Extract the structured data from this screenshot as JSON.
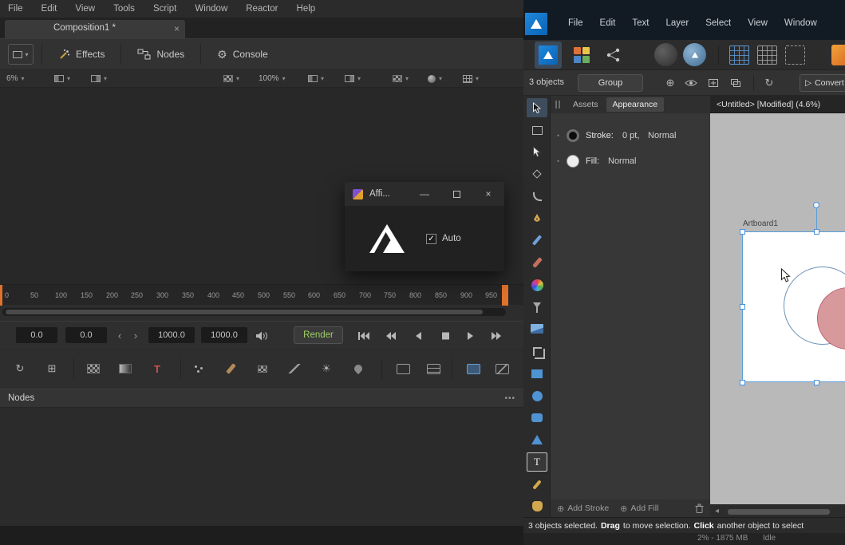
{
  "colors": {
    "accent_blue": "#4a90d9",
    "render_green": "#9ccf63",
    "timeline_orange": "#e0722c",
    "pink_fill": "#d8999d",
    "affinity_blue": "#1a86d8"
  },
  "icons": {
    "close": "×",
    "gear": "⚙",
    "prev": "‹",
    "next": "›",
    "dots_menu": "•••",
    "check": "✓",
    "minimize": "—",
    "bullet": "•",
    "plus": "⊕",
    "crosshair": "⊕",
    "rotate": "↻",
    "sun": "☀",
    "loader": "↻",
    "node_grid": "⊞",
    "scroll_left_arrow": "◂",
    "play_small": "▷",
    "text_tool": "T",
    "text_plus": "T"
  },
  "fusion": {
    "menu": [
      "File",
      "Edit",
      "View",
      "Tools",
      "Script",
      "Window",
      "Reactor",
      "Help"
    ],
    "tab_title": "Composition1 *",
    "toolbar": {
      "effects": "Effects",
      "nodes": "Nodes",
      "console": "Console"
    },
    "viewer_controls": {
      "zoom_left": "6%",
      "zoom_right": "100%"
    },
    "ruler_ticks": [
      "0",
      "50",
      "100",
      "150",
      "200",
      "250",
      "300",
      "350",
      "400",
      "450",
      "500",
      "550",
      "600",
      "650",
      "700",
      "750",
      "800",
      "850",
      "900",
      "950"
    ],
    "transport": {
      "range_start": "0.0",
      "current": "0.0",
      "range_end": "1000.0",
      "global_end": "1000.0",
      "render": "Render"
    },
    "nodes_panel_title": "Nodes",
    "status_memory": "2% - 1875 MB",
    "status_state": "Idle"
  },
  "dialog": {
    "title": "Affi...",
    "auto": "Auto"
  },
  "affinity": {
    "menu": [
      "File",
      "Edit",
      "Text",
      "Layer",
      "Select",
      "View",
      "Window"
    ],
    "context": {
      "objects": "3 objects",
      "group": "Group",
      "convert": "Convert t"
    },
    "panel": {
      "tab_assets": "Assets",
      "tab_appearance": "Appearance",
      "stroke_label": "Stroke:",
      "stroke_width": "0 pt,",
      "stroke_blend": "Normal",
      "fill_label": "Fill:",
      "fill_blend": "Normal",
      "add_stroke": "Add Stroke",
      "add_fill": "Add Fill"
    },
    "doc_title": "<Untitled> [Modified] (4.6%)",
    "artboard_label": "Artboard1",
    "statusbar": {
      "pre": "3 objects selected.",
      "drag": "Drag",
      "mid": "to move selection.",
      "click": "Click",
      "post": "another object to select"
    }
  }
}
